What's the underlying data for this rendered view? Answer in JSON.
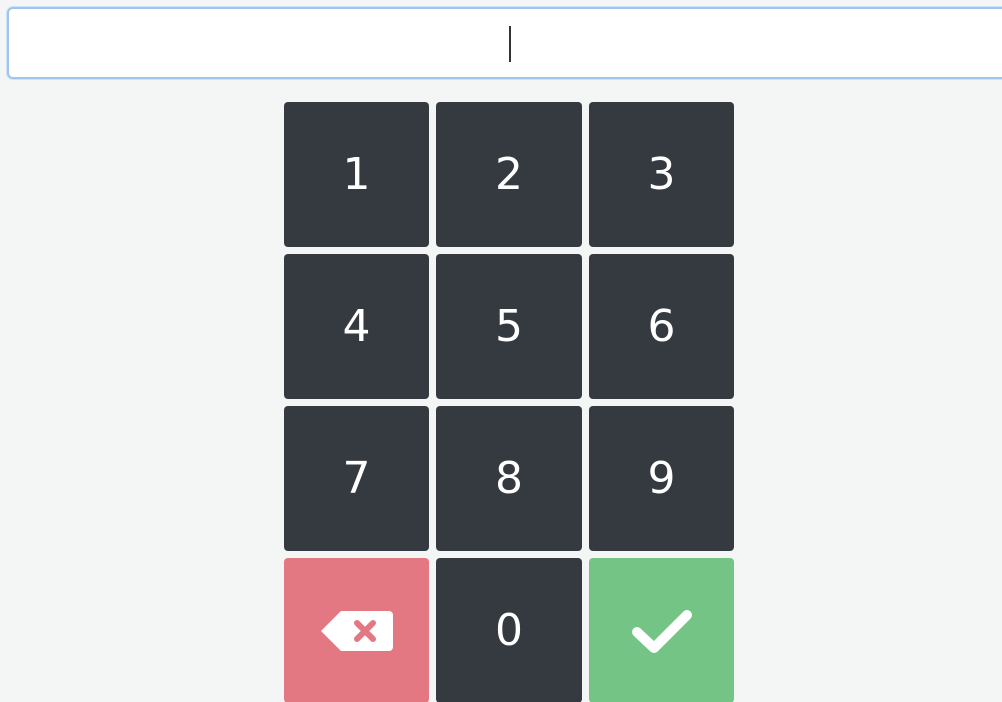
{
  "pin_input": {
    "value": ""
  },
  "keypad": {
    "keys": [
      "1",
      "2",
      "3",
      "4",
      "5",
      "6",
      "7",
      "8",
      "9"
    ],
    "zero": "0",
    "delete_icon": "backspace-icon",
    "confirm_icon": "check-icon"
  },
  "colors": {
    "key_background": "#343a40",
    "delete_background": "#e47882",
    "confirm_background": "#74c486",
    "input_border": "#9ec5ef",
    "page_background": "#f4f5f5"
  }
}
